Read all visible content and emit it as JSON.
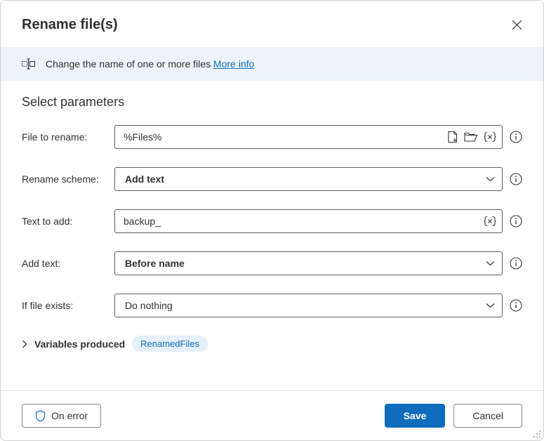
{
  "header": {
    "title": "Rename file(s)"
  },
  "banner": {
    "text": "Change the name of one or more files",
    "link": "More info"
  },
  "section": {
    "title": "Select parameters"
  },
  "fields": {
    "file_to_rename": {
      "label": "File to rename:",
      "value": "%Files%"
    },
    "rename_scheme": {
      "label": "Rename scheme:",
      "value": "Add text"
    },
    "text_to_add": {
      "label": "Text to add:",
      "value": "backup_"
    },
    "add_text": {
      "label": "Add text:",
      "value": "Before name"
    },
    "if_file_exists": {
      "label": "If file exists:",
      "value": "Do nothing"
    }
  },
  "variables": {
    "label": "Variables produced",
    "pill": "RenamedFiles"
  },
  "footer": {
    "on_error": "On error",
    "save": "Save",
    "cancel": "Cancel"
  }
}
